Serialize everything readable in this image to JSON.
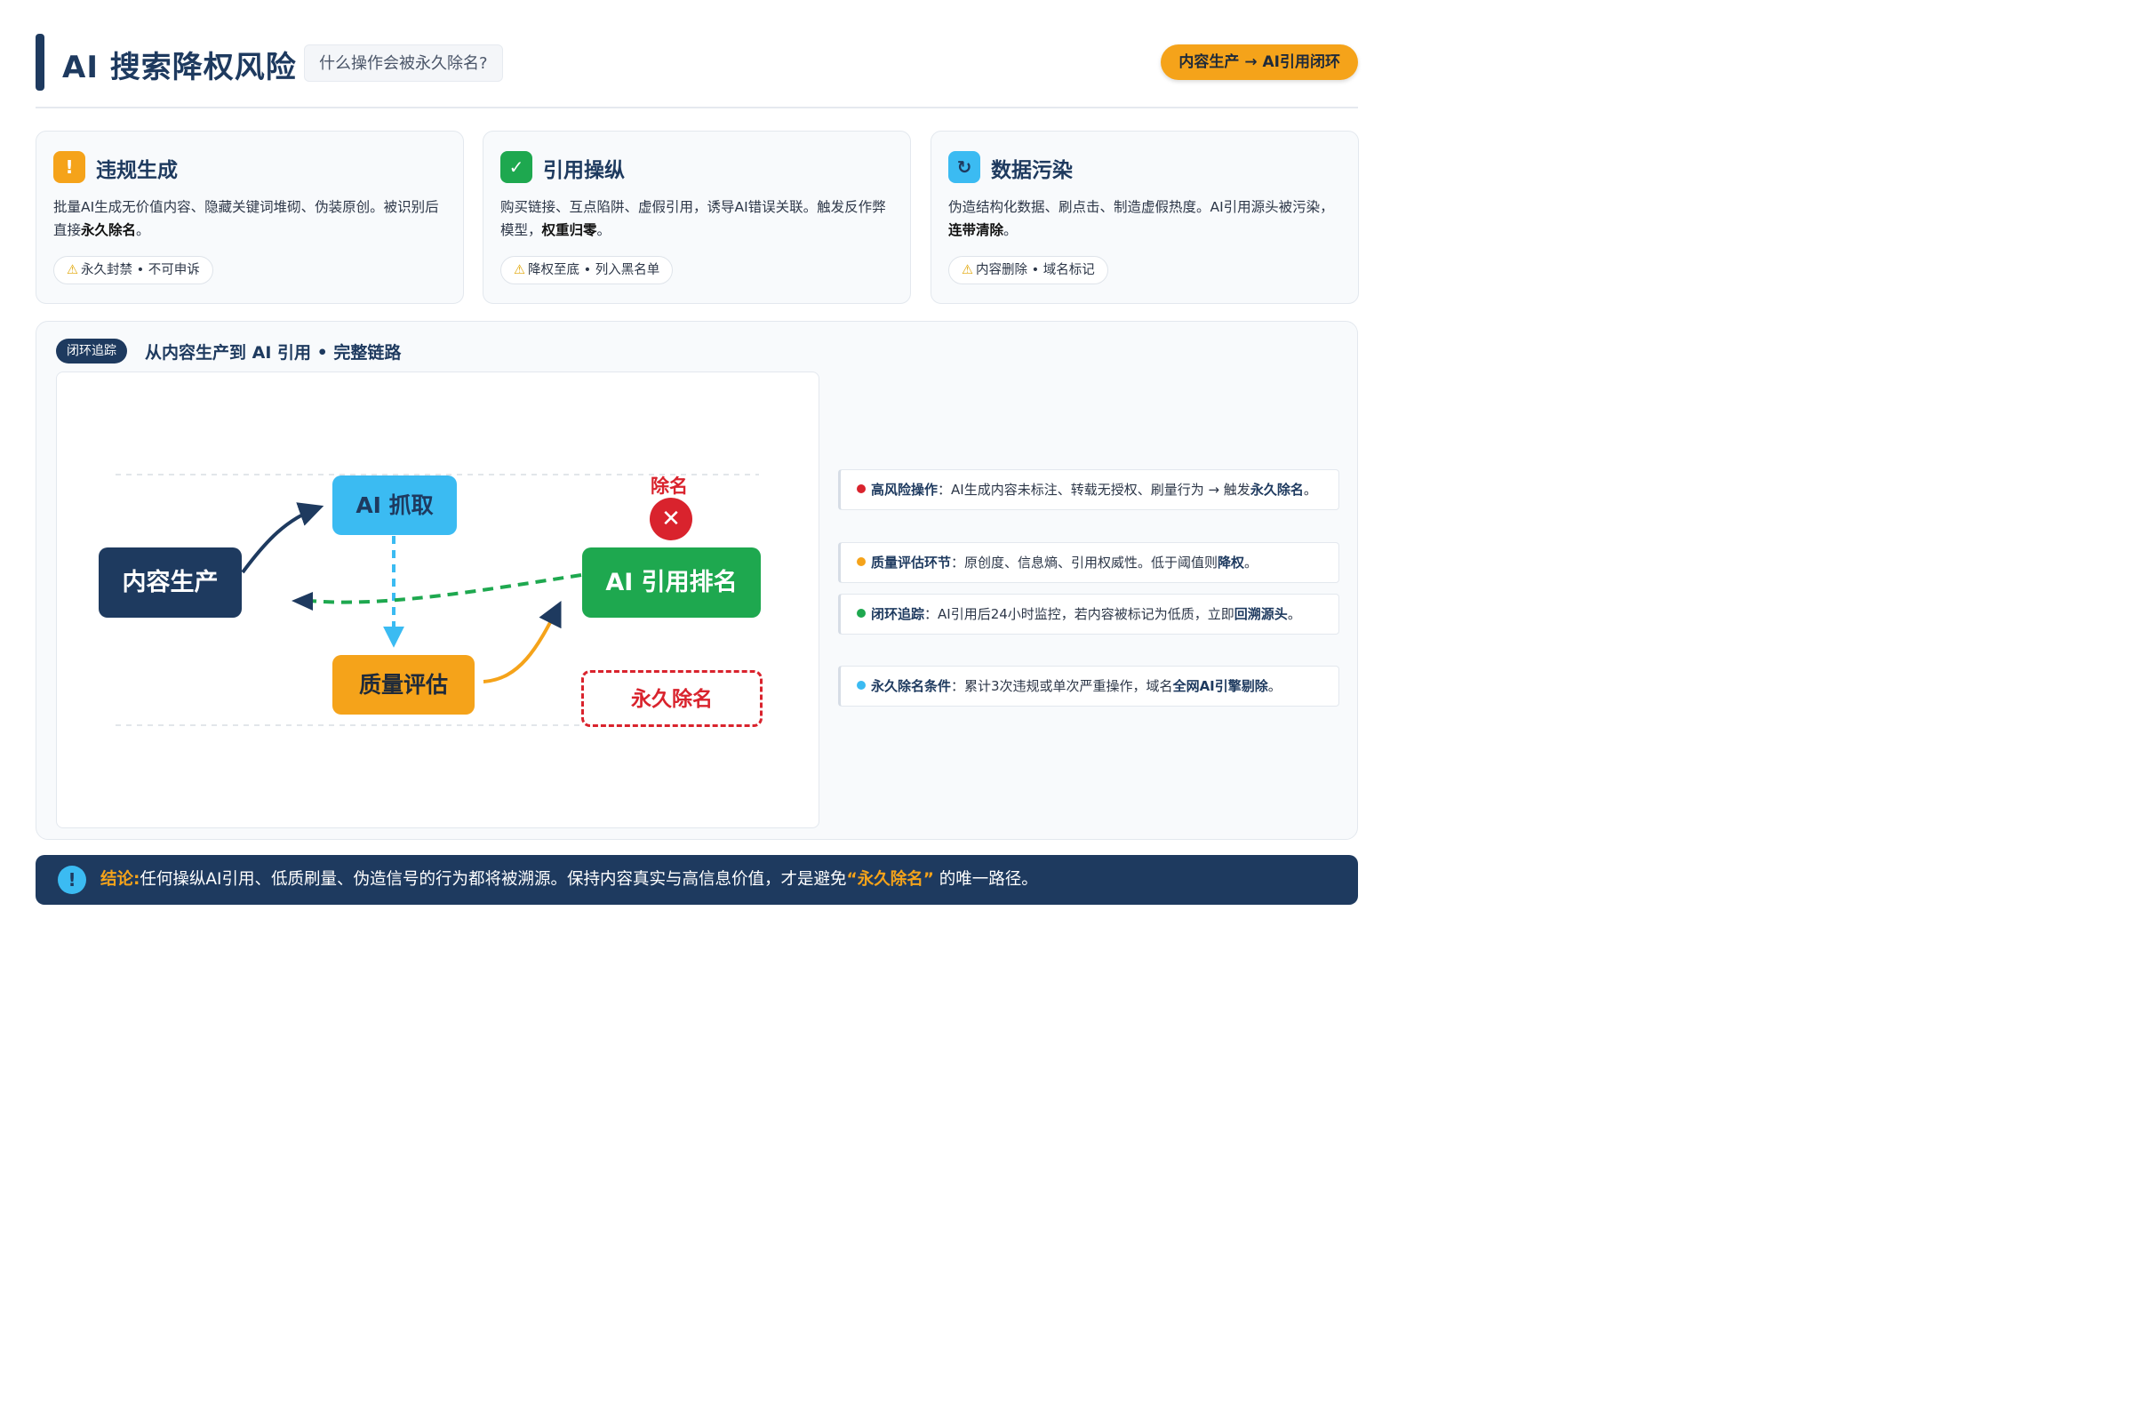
{
  "header": {
    "title": "AI 搜索降权风险",
    "subtitle": "什么操作会被永久除名?",
    "pill": "内容生产 → AI引用闭环"
  },
  "cards": [
    {
      "icon": "!",
      "icon_name": "exclamation-icon",
      "color": "#f5a31a",
      "title": "违规生成",
      "text_pre": "批量AI生成无价值内容、隐藏关键词堆砌、伪装原创。被识别后直接",
      "text_bold": "永久除名",
      "text_post": "。",
      "tag": "永久封禁 • 不可申诉"
    },
    {
      "icon": "✓",
      "icon_name": "check-icon",
      "color": "#1ea84f",
      "title": "引用操纵",
      "text_pre": "购买链接、互点陷阱、虚假引用，诱导AI错误关联。触发反作弊模型，",
      "text_bold": "权重归零",
      "text_post": "。",
      "tag": "降权至底 • 列入黑名单"
    },
    {
      "icon": "↻",
      "icon_name": "refresh-icon",
      "color": "#3bbbf2",
      "title": "数据污染",
      "text_pre": "伪造结构化数据、刷点击、制造虚假热度。AI引用源头被污染，",
      "text_bold": "连带清除",
      "text_post": "。",
      "tag": "内容删除 • 域名标记"
    }
  ],
  "flow": {
    "badge": "闭环追踪",
    "heading": "从内容生产到 AI 引用 • 完整链路",
    "nodes": {
      "produce": "内容生产",
      "crawl": "AI 抓取",
      "quality": "质量评估",
      "rank": "AI 引用排名",
      "permanent": "永久除名"
    },
    "remove_label": "除名",
    "remove_icon": "✕"
  },
  "notes": [
    {
      "color": "#d9232d",
      "label": "高风险操作",
      "text": "：AI生成内容未标注、转载无授权、刷量行为 → 触发",
      "highlight": "永久除名",
      "tail": "。"
    },
    {
      "color": "#f5a31a",
      "label": "质量评估环节",
      "text": "：原创度、信息熵、引用权威性。低于阈值则",
      "highlight": "降权",
      "tail": "。"
    },
    {
      "color": "#1ea84f",
      "label": "闭环追踪",
      "text": "：AI引用后24小时监控，若内容被标记为低质，立即",
      "highlight": "回溯源头",
      "tail": "。"
    },
    {
      "color": "#3bbbf2",
      "label": "永久除名条件",
      "text": "：累计3次违规或单次严重操作，域名",
      "highlight": "全网AI引擎剔除",
      "tail": "。"
    }
  ],
  "conclusion": {
    "icon": "!",
    "label": "结论:",
    "text": "任何操纵AI引用、低质刷量、伪造信号的行为都将被溯源。保持内容真实与高信息价值，才是避免",
    "highlight": "“永久除名”",
    "tail": " 的唯一路径。"
  },
  "colors": {
    "navy": "#1e3a5f",
    "orange": "#f5a31a",
    "green": "#1ea84f",
    "sky": "#3bbbf2",
    "red": "#d9232d"
  }
}
